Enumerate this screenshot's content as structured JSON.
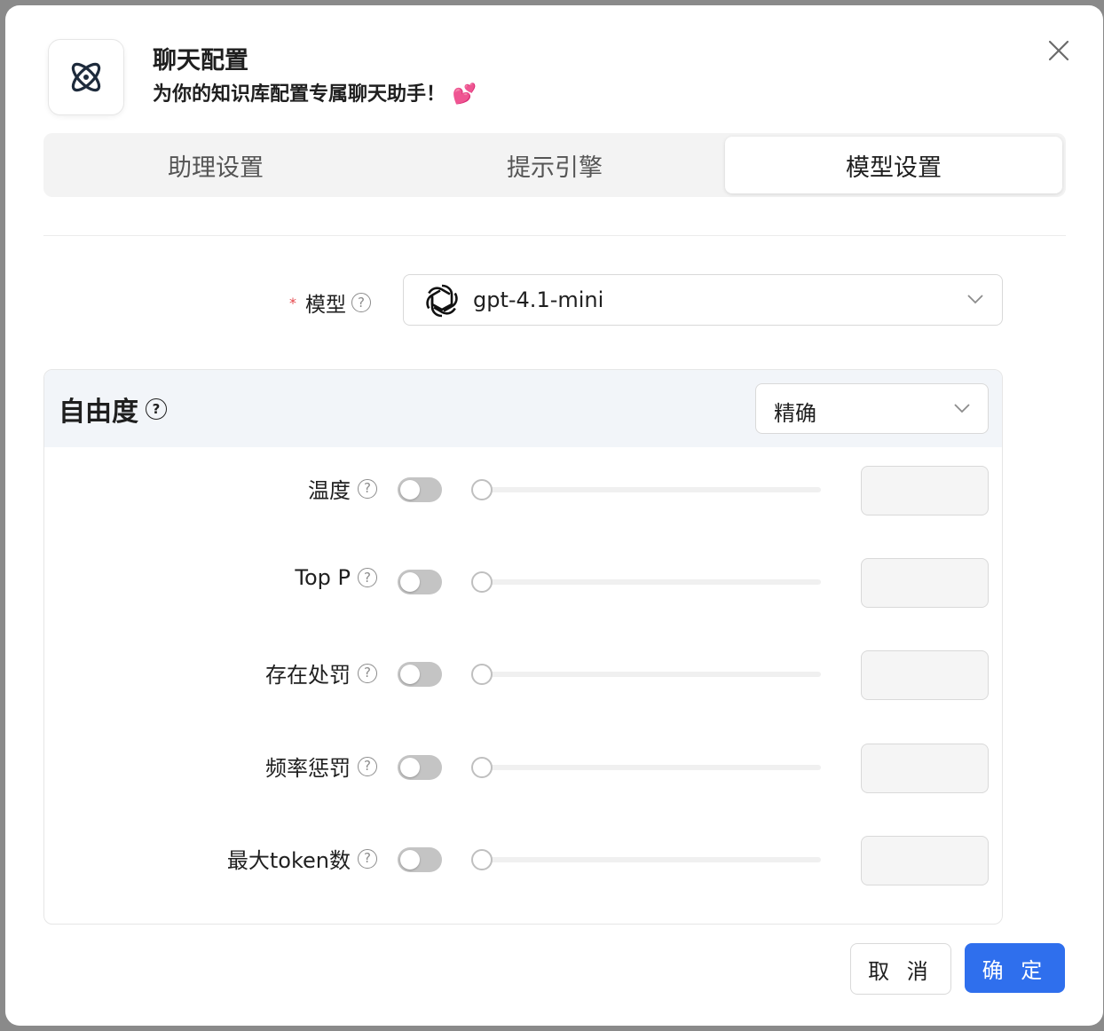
{
  "header": {
    "title": "聊天配置",
    "subtitle": "为你的知识库配置专属聊天助手！ 💕"
  },
  "tabs": [
    {
      "label": "助理设置",
      "active": false
    },
    {
      "label": "提示引擎",
      "active": false
    },
    {
      "label": "模型设置",
      "active": true
    }
  ],
  "model": {
    "label": "模型",
    "required_mark": "*",
    "value": "gpt-4.1-mini",
    "icon": "openai-icon"
  },
  "freedom": {
    "title": "自由度",
    "preset": "精确",
    "params": [
      {
        "label": "温度",
        "enabled": false,
        "value": ""
      },
      {
        "label": "Top P",
        "enabled": false,
        "value": ""
      },
      {
        "label": "存在处罚",
        "enabled": false,
        "value": ""
      },
      {
        "label": "频率惩罚",
        "enabled": false,
        "value": ""
      },
      {
        "label": "最大token数",
        "enabled": false,
        "value": ""
      }
    ]
  },
  "footer": {
    "cancel_label": "取 消",
    "ok_label": "确 定"
  },
  "colors": {
    "primary": "#2f6fed",
    "required": "#e5484d",
    "toggle_off": "#c4c4c4"
  }
}
